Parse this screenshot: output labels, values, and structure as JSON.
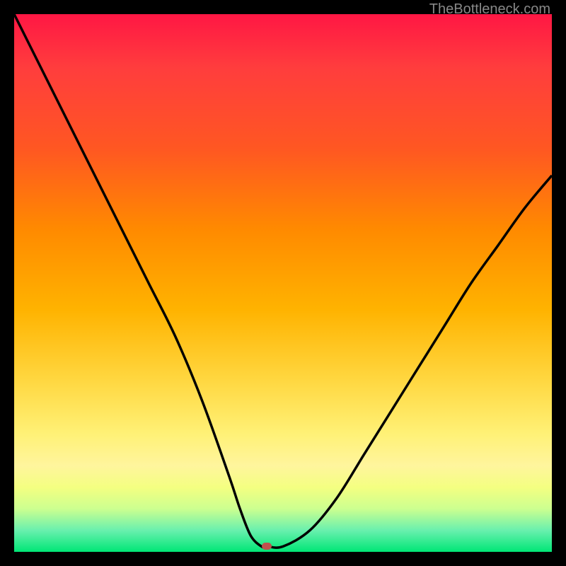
{
  "watermark": "TheBottleneck.com",
  "chart_data": {
    "type": "line",
    "title": "",
    "xlabel": "",
    "ylabel": "",
    "xlim": [
      0,
      100
    ],
    "ylim": [
      0,
      100
    ],
    "series": [
      {
        "name": "bottleneck-curve",
        "x": [
          0,
          5,
          10,
          15,
          20,
          25,
          30,
          35,
          40,
          42,
          44,
          46,
          47,
          50,
          55,
          60,
          65,
          70,
          75,
          80,
          85,
          90,
          95,
          100
        ],
        "values": [
          100,
          90,
          80,
          70,
          60,
          50,
          40,
          28,
          14,
          8,
          3,
          1,
          1,
          1,
          4,
          10,
          18,
          26,
          34,
          42,
          50,
          57,
          64,
          70
        ]
      }
    ],
    "marker": {
      "x": 47,
      "y": 1,
      "color": "#c0504d"
    },
    "background_gradient": {
      "orientation": "vertical",
      "stops": [
        {
          "pos": 0,
          "color": "#ff1744"
        },
        {
          "pos": 25,
          "color": "#ff5722"
        },
        {
          "pos": 55,
          "color": "#ffb300"
        },
        {
          "pos": 78,
          "color": "#fff176"
        },
        {
          "pos": 92,
          "color": "#ccff90"
        },
        {
          "pos": 100,
          "color": "#00e676"
        }
      ]
    }
  }
}
